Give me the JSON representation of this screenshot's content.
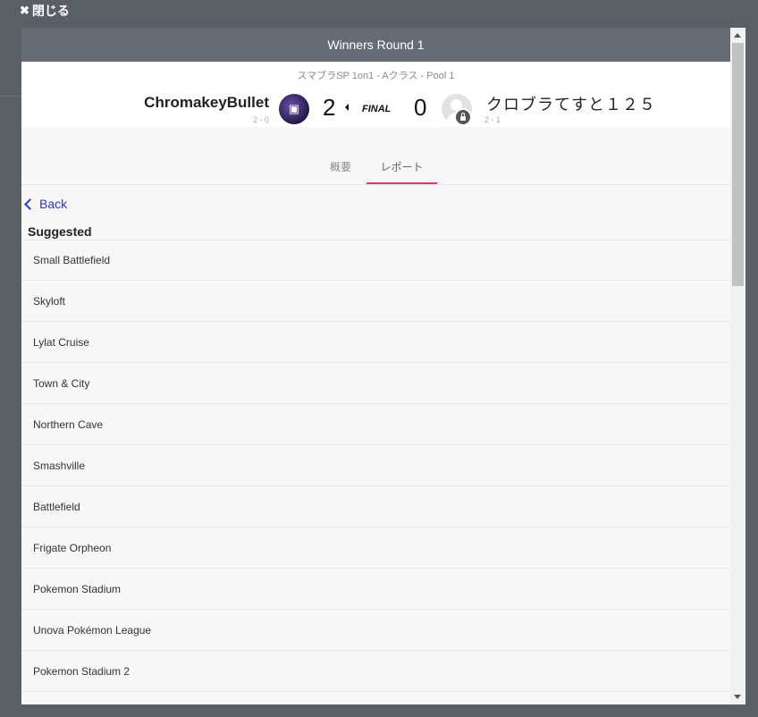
{
  "close": {
    "label": "閉じる",
    "icon": "close-icon"
  },
  "modal": {
    "title": "Winners Round 1",
    "event": "スマブラSP 1on1 - Aクラス - Pool 1",
    "player1": {
      "name": "ChromakeyBullet",
      "record": "2 - 0",
      "score": "2"
    },
    "status": "FINAL",
    "player2": {
      "name": "クロブラてすと１２５",
      "record": "2 - 1",
      "score": "0"
    },
    "tabs": {
      "overview": "概要",
      "report": "レポート"
    },
    "back_label": "Back",
    "section_title": "Suggested",
    "stages": [
      "Small Battlefield",
      "Skyloft",
      "Lylat Cruise",
      "Town & City",
      "Northern Cave",
      "Smashville",
      "Battlefield",
      "Frigate Orpheon",
      "Pokemon Stadium",
      "Unova Pokémon League",
      "Pokemon Stadium 2"
    ]
  },
  "colors": {
    "header": "#666c73",
    "accent": "#e0307a",
    "link": "#2b35c9"
  }
}
